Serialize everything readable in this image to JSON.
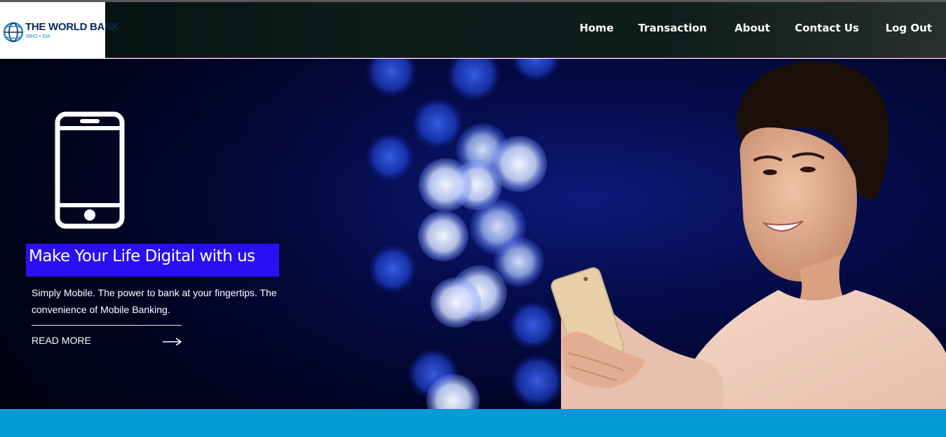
{
  "brand": {
    "name": "THE WORLD BANK",
    "sub": "IBRD • IDA",
    "logo_icon": "globe-icon"
  },
  "nav": {
    "items": [
      {
        "label": "Home"
      },
      {
        "label": "Transaction"
      },
      {
        "label": "About"
      },
      {
        "label": "Contact Us"
      },
      {
        "label": "Log Out"
      }
    ]
  },
  "hero": {
    "icon": "mobile-phone-icon",
    "headline": "Make Your Life Digital with us",
    "description": "Simply Mobile. The power to bank at your fingertips. The convenience of Mobile Banking.",
    "cta_label": "READ MORE",
    "cta_icon": "arrow-right-icon"
  },
  "colors": {
    "headline_bg": "#2a0ff2",
    "bottom_band": "#039bd7",
    "header_bg": "#0b1c19"
  }
}
